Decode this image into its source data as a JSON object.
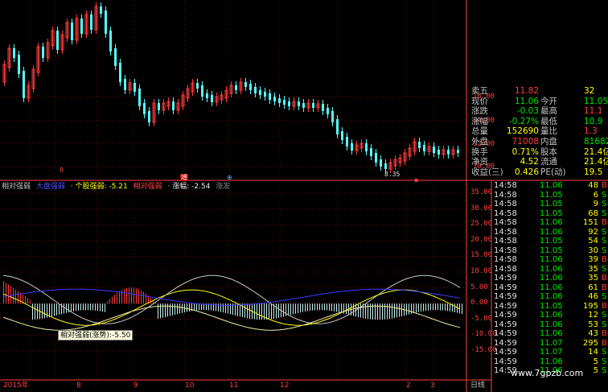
{
  "colors": {
    "up": "#ff3c3c",
    "down": "#54fcfc",
    "yellow": "#ffff00",
    "white": "#e8e8e8",
    "grid": "#800000",
    "axis_red": "#ff4040",
    "blue": "#3c3cff",
    "green": "#00e600"
  },
  "price_axis": [
    "16.00",
    "14.00",
    "12.00",
    "10.00"
  ],
  "price_flags": {
    "low_label": "8.35",
    "mark_zeng": "增",
    "mark_red": "8",
    "mark_blue": "⊕",
    "mark_red2": "▪"
  },
  "indicator": {
    "name": "相对强弱",
    "series": [
      {
        "name": "大盘强弱",
        "value": "",
        "color": "#5050ff"
      },
      {
        "name": "个股强弱",
        "value": "-5.21",
        "color": "#ffff00"
      },
      {
        "name": "相对强弱",
        "value": "",
        "color": "#ff4040"
      },
      {
        "name": "涨幅",
        "value": "-2.54",
        "color": "#e8e8e8"
      }
    ],
    "truncated_tail": "涨发",
    "axis": [
      "35.00",
      "30.00",
      "25.00",
      "20.00",
      "15.00",
      "10.00",
      "5.00",
      "0.00",
      "-5.00",
      "-10.00",
      "-15.00"
    ],
    "tooltip": "相对强弱(涨势):-5.50"
  },
  "time_axis": {
    "labels": [
      "2015年",
      "8",
      "9",
      "10",
      "11",
      "12",
      "2",
      "3"
    ],
    "period": "日线"
  },
  "quote": {
    "rows": [
      {
        "l1": "卖五",
        "v1": "11.82",
        "l2": "",
        "v2": "32",
        "c1": "#ff3c3c",
        "c2": "#ffff00"
      },
      {
        "l1": "现价",
        "v1": "11.06",
        "l2": "今开",
        "v2": "11.05",
        "c1": "#00e600",
        "c2": "#00e600"
      },
      {
        "l1": "涨跌",
        "v1": "-0.03",
        "l2": "最高",
        "v2": "11.1",
        "c1": "#00e600",
        "c2": "#ff3c3c"
      },
      {
        "l1": "涨幅",
        "v1": "-0.27%",
        "l2": "最低",
        "v2": "10.9",
        "c1": "#00e600",
        "c2": "#00e600"
      },
      {
        "l1": "总量",
        "v1": "152690",
        "l2": "量比",
        "v2": "1.3",
        "c1": "#ffff00",
        "c2": "#ff3c3c"
      },
      {
        "l1": "外盘",
        "v1": "71008",
        "l2": "内盘",
        "v2": "81682",
        "c1": "#ff3c3c",
        "c2": "#00e600"
      },
      {
        "l1": "换手",
        "v1": "0.71%",
        "l2": "股本",
        "v2": "21.4亿",
        "c1": "#ffff00",
        "c2": "#ffff00"
      },
      {
        "l1": "净资",
        "v1": "4.52",
        "l2": "流通",
        "v2": "21.4亿",
        "c1": "#ffff00",
        "c2": "#ffff00"
      },
      {
        "l1": "收益(三)",
        "v1": "0.426",
        "l2": "PE(动)",
        "v2": "19.5",
        "c1": "#ffff00",
        "c2": "#ffff00"
      }
    ]
  },
  "ticks": [
    {
      "t": "14:58",
      "p": "11.06",
      "v": "48",
      "f": "B"
    },
    {
      "t": "14:58",
      "p": "11.05",
      "v": "6",
      "f": "S"
    },
    {
      "t": "14:58",
      "p": "11.05",
      "v": "9",
      "f": "S"
    },
    {
      "t": "14:58",
      "p": "11.05",
      "v": "68",
      "f": "S"
    },
    {
      "t": "14:58",
      "p": "11.06",
      "v": "151",
      "f": "B"
    },
    {
      "t": "14:58",
      "p": "11.06",
      "v": "92",
      "f": "S"
    },
    {
      "t": "14:58",
      "p": "11.05",
      "v": "54",
      "f": "S"
    },
    {
      "t": "14:58",
      "p": "11.05",
      "v": "30",
      "f": "S"
    },
    {
      "t": "14:58",
      "p": "11.06",
      "v": "39",
      "f": "B"
    },
    {
      "t": "14:58",
      "p": "11.06",
      "v": "35",
      "f": "S"
    },
    {
      "t": "14:59",
      "p": "11.06",
      "v": "35",
      "f": "B"
    },
    {
      "t": "14:59",
      "p": "11.06",
      "v": "61",
      "f": "B"
    },
    {
      "t": "14:59",
      "p": "11.06",
      "v": "46",
      "f": "S"
    },
    {
      "t": "14:59",
      "p": "11.05",
      "v": "195",
      "f": "B"
    },
    {
      "t": "14:59",
      "p": "11.06",
      "v": "12",
      "f": "S"
    },
    {
      "t": "14:59",
      "p": "11.06",
      "v": "53",
      "f": "S"
    },
    {
      "t": "14:59",
      "p": "11.06",
      "v": "43",
      "f": "B"
    },
    {
      "t": "14:59",
      "p": "11.07",
      "v": "295",
      "f": "B"
    },
    {
      "t": "14:59",
      "p": "11.07",
      "v": "14",
      "f": "S"
    },
    {
      "t": "14:59",
      "p": "11.06",
      "v": "5",
      "f": "S"
    },
    {
      "t": "14:59",
      "p": "11.06",
      "v": "5",
      "f": "S"
    }
  ],
  "watermark": "www.7gpzb.com"
}
